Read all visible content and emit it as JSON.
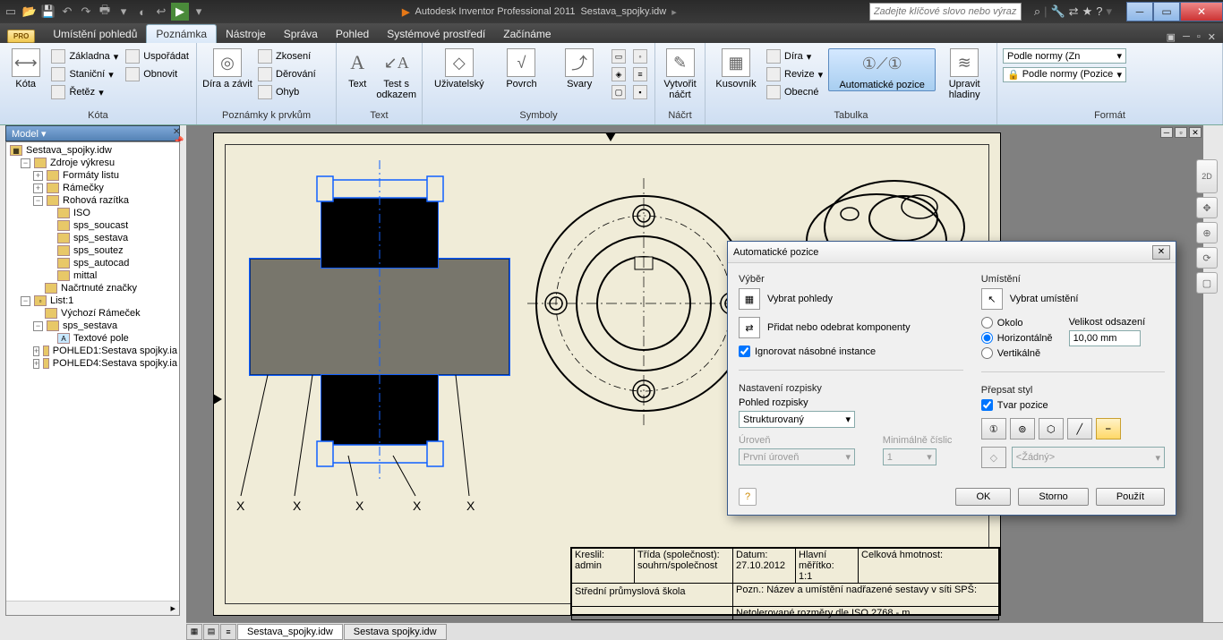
{
  "title": {
    "app": "Autodesk Inventor Professional 2011",
    "doc": "Sestava_spojky.idw",
    "search_ph": "Zadejte klíčové slovo nebo výraz.",
    "pro": "PRO"
  },
  "tabs": {
    "t1": "Umístění pohledů",
    "t2": "Poznámka",
    "t3": "Nástroje",
    "t4": "Správa",
    "t5": "Pohled",
    "t6": "Systémové prostředí",
    "t7": "Začínáme"
  },
  "ribbon": {
    "kota": {
      "big": "Kóta",
      "s1": "Základna",
      "s2": "Staniční",
      "s3": "Řetěz",
      "s4": "Uspořádat",
      "s5": "Obnovit",
      "title": "Kóta"
    },
    "pozn": {
      "big": "Díra a závit",
      "s1": "Zkosení",
      "s2": "Děrování",
      "s3": "Ohyb",
      "title": "Poznámky k prvkům"
    },
    "text": {
      "b1": "Text",
      "b2": "Test s odkazem",
      "title": "Text"
    },
    "sym": {
      "b1": "Uživatelský",
      "b2": "Povrch",
      "b3": "Svary",
      "title": "Symboly"
    },
    "nacrt": {
      "b1": "Vytvořit náčrt",
      "title": "Náčrt"
    },
    "tab": {
      "b1": "Kusovník",
      "s1": "Díra",
      "s2": "Revize",
      "s3": "Obecné",
      "b2": "Automatické pozice",
      "b3": "Upravit hladiny",
      "title": "Tabulka"
    },
    "fmt": {
      "s1": "Podle normy (Zn",
      "s2": "Podle normy (Pozice",
      "title": "Formát"
    }
  },
  "model": {
    "hdr": "Model ▾",
    "root": "Sestava_spojky.idw",
    "n1": "Zdroje výkresu",
    "n2": "Formáty listu",
    "n3": "Rámečky",
    "n4": "Rohová razítka",
    "n5": "ISO",
    "n6": "sps_soucast",
    "n7": "sps_sestava",
    "n8": "sps_soutez",
    "n9": "sps_autocad",
    "n10": "mittal",
    "n11": "Načrtnuté značky",
    "n12": "List:1",
    "n13": "Výchozí Rámeček",
    "n14": "sps_sestava",
    "n15": "Textové pole",
    "n16": "POHLED1:Sestava spojky.ia",
    "n17": "POHLED4:Sestava spojky.ia"
  },
  "dialog": {
    "title": "Automatické pozice",
    "vyber": "Výběr",
    "vybpoh": "Vybrat pohledy",
    "pridat": "Přidat nebo odebrat komponenty",
    "ignor": "Ignorovat násobné instance",
    "nast": "Nastavení rozpisky",
    "pohroz": "Pohled rozpisky",
    "strukt": "Strukturovaný",
    "uroven": "Úroveň",
    "prvni": "První úroveň",
    "mincis": "Minimálně číslic",
    "one": "1",
    "umist": "Umístění",
    "vyum": "Vybrat umístění",
    "okolo": "Okolo",
    "horiz": "Horizontálně",
    "vert": "Vertikálně",
    "velods": "Velikost odsazení",
    "mm": "10,00 mm",
    "prep": "Přepsat styl",
    "tvar": "Tvar pozice",
    "zadny": "<Žádný>",
    "ok": "OK",
    "storno": "Storno",
    "pouzit": "Použít"
  },
  "bottom": {
    "t1": "Sestava_spojky.idw",
    "t2": "Sestava spojky.idw"
  },
  "tblock": {
    "kreslil_h": "Kreslil:",
    "kreslil": "admin",
    "trida_h": "Třída (společnost):",
    "trida": "souhrn/společnost",
    "datum_h": "Datum:",
    "datum": "27.10.2012",
    "merit_h": "Hlavní měřítko:",
    "merit": "1:1",
    "hmot_h": "Celková hmotnost:",
    "skola": "Střední průmyslová škola",
    "pozn": "Pozn.: Název a umístění nadřazené sestavy v síti SPŠ:",
    "netol": "Netolerované rozměry dle ISO 2768 - m"
  },
  "x": "X"
}
